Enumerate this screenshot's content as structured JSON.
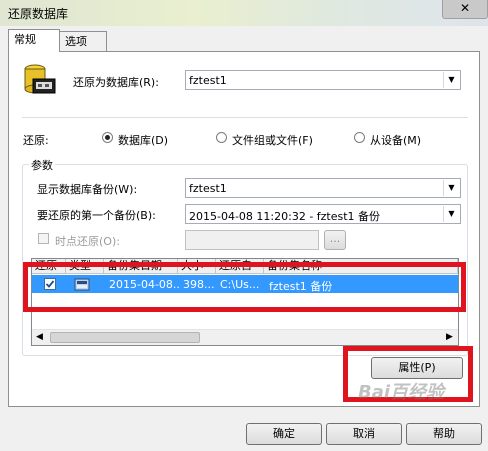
{
  "window": {
    "title": "还原数据库",
    "close_glyph": "✕"
  },
  "tabs": [
    {
      "label": "常规",
      "active": true
    },
    {
      "label": "选项",
      "active": false
    }
  ],
  "restore_to": {
    "label": "还原为数据库(R):",
    "value": "fztest1"
  },
  "restore_source": {
    "label": "还原:",
    "options": [
      {
        "label": "数据库(D)",
        "selected": true
      },
      {
        "label": "文件组或文件(F)",
        "selected": false
      },
      {
        "label": "从设备(M)",
        "selected": false
      }
    ]
  },
  "params": {
    "title": "参数",
    "show_backups_label": "显示数据库备份(W):",
    "show_backups_value": "fztest1",
    "first_backup_label": "要还原的第一个备份(B):",
    "first_backup_value": "2015-04-08 11:20:32 - fztest1 备份",
    "point_in_time_label": "时点还原(O):",
    "point_in_time_value": "",
    "browse_label": "..."
  },
  "grid": {
    "columns": [
      "还原",
      "类型",
      "备份集日期",
      "大小",
      "还原自",
      "备份集名称"
    ],
    "rows": [
      {
        "restore": true,
        "date": "2015-04-08...",
        "size": "398...",
        "from": "C:\\Us...",
        "name": "fztest1 备份"
      }
    ],
    "scroll_left": "◀",
    "scroll_right": "▶"
  },
  "buttons": {
    "properties": "属性(P)",
    "ok": "确定",
    "cancel": "取消",
    "help": "帮助"
  },
  "watermark": "Bai百经验"
}
